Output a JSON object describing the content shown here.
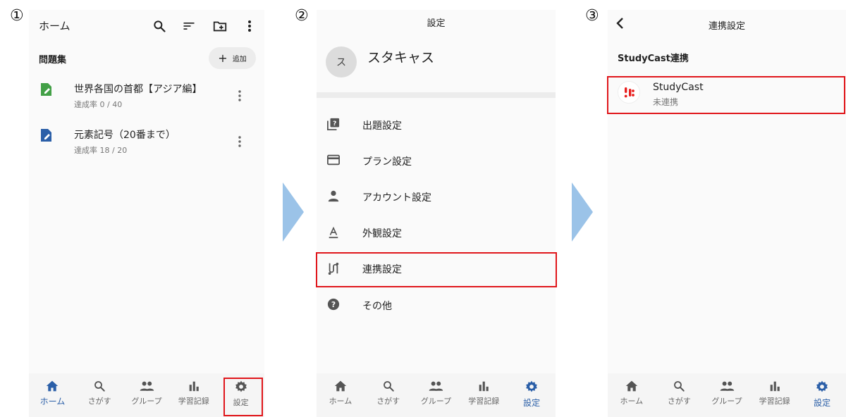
{
  "steps": [
    "①",
    "②",
    "③"
  ],
  "colors": {
    "accent": "#2b5fa8",
    "highlight": "#e0161b",
    "arrow": "#9bc3e8",
    "brand_studycast": "#e8201f"
  },
  "screen1": {
    "title": "ホーム",
    "toolbar_icons": [
      "search-icon",
      "sort-icon",
      "new-folder-icon",
      "more-vert-icon"
    ],
    "section_title": "問題集",
    "add_label": "追加",
    "items": [
      {
        "title": "世界各国の首都【アジア編】",
        "subtitle": "達成率 0 / 40",
        "icon": "green-edit-doc-icon"
      },
      {
        "title": "元素記号（20番まで）",
        "subtitle": "達成率 18 / 20",
        "icon": "blue-edit-doc-icon"
      }
    ]
  },
  "screen2": {
    "title": "設定",
    "avatar_letter": "ス",
    "profile_name": "スタキャス",
    "menu": [
      {
        "label": "出題設定",
        "icon": "quiz-icon"
      },
      {
        "label": "プラン設定",
        "icon": "card-icon"
      },
      {
        "label": "アカウント設定",
        "icon": "person-icon"
      },
      {
        "label": "外観設定",
        "icon": "text-format-icon"
      },
      {
        "label": "連携設定",
        "icon": "link-route-icon"
      },
      {
        "label": "その他",
        "icon": "help-icon"
      }
    ]
  },
  "screen3": {
    "title": "連携設定",
    "section_title": "StudyCast連携",
    "service_name": "StudyCast",
    "service_status": "未連携"
  },
  "tabs": [
    "ホーム",
    "さがす",
    "グループ",
    "学習記録",
    "設定"
  ],
  "active_tab": {
    "screen1": "ホーム",
    "screen2": "設定",
    "screen3": "設定"
  }
}
